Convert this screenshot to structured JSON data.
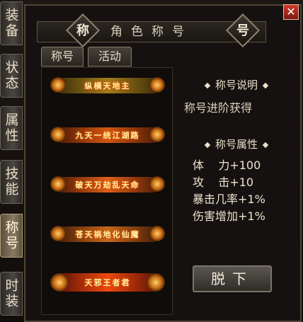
{
  "window": {
    "title": "角色称号",
    "left_badge": "称",
    "right_badge": "号",
    "close_label": "✕"
  },
  "side_tabs": [
    {
      "label": "装备"
    },
    {
      "label": "状态"
    },
    {
      "label": "属性"
    },
    {
      "label": "技能"
    },
    {
      "label": "称号"
    },
    {
      "label": "时装"
    }
  ],
  "top_tabs": [
    {
      "label": "称号"
    },
    {
      "label": "活动"
    }
  ],
  "titles": [
    {
      "label": "纵横天地主"
    },
    {
      "label": "九天一统江湖路"
    },
    {
      "label": "破天万劫乱天命"
    },
    {
      "label": "苍天祸地化仙魔"
    },
    {
      "label": "天邪王者君"
    }
  ],
  "info": {
    "desc_header": "称号说明",
    "desc_text": "称号进阶获得",
    "attr_header": "称号属性",
    "attrs": [
      {
        "text": "体    力+100"
      },
      {
        "text": "攻    击+10"
      },
      {
        "text": "暴击几率+1%"
      },
      {
        "text": "伤害增加+1%"
      }
    ]
  },
  "remove_button": "脱下",
  "active_side_tab": "称号"
}
